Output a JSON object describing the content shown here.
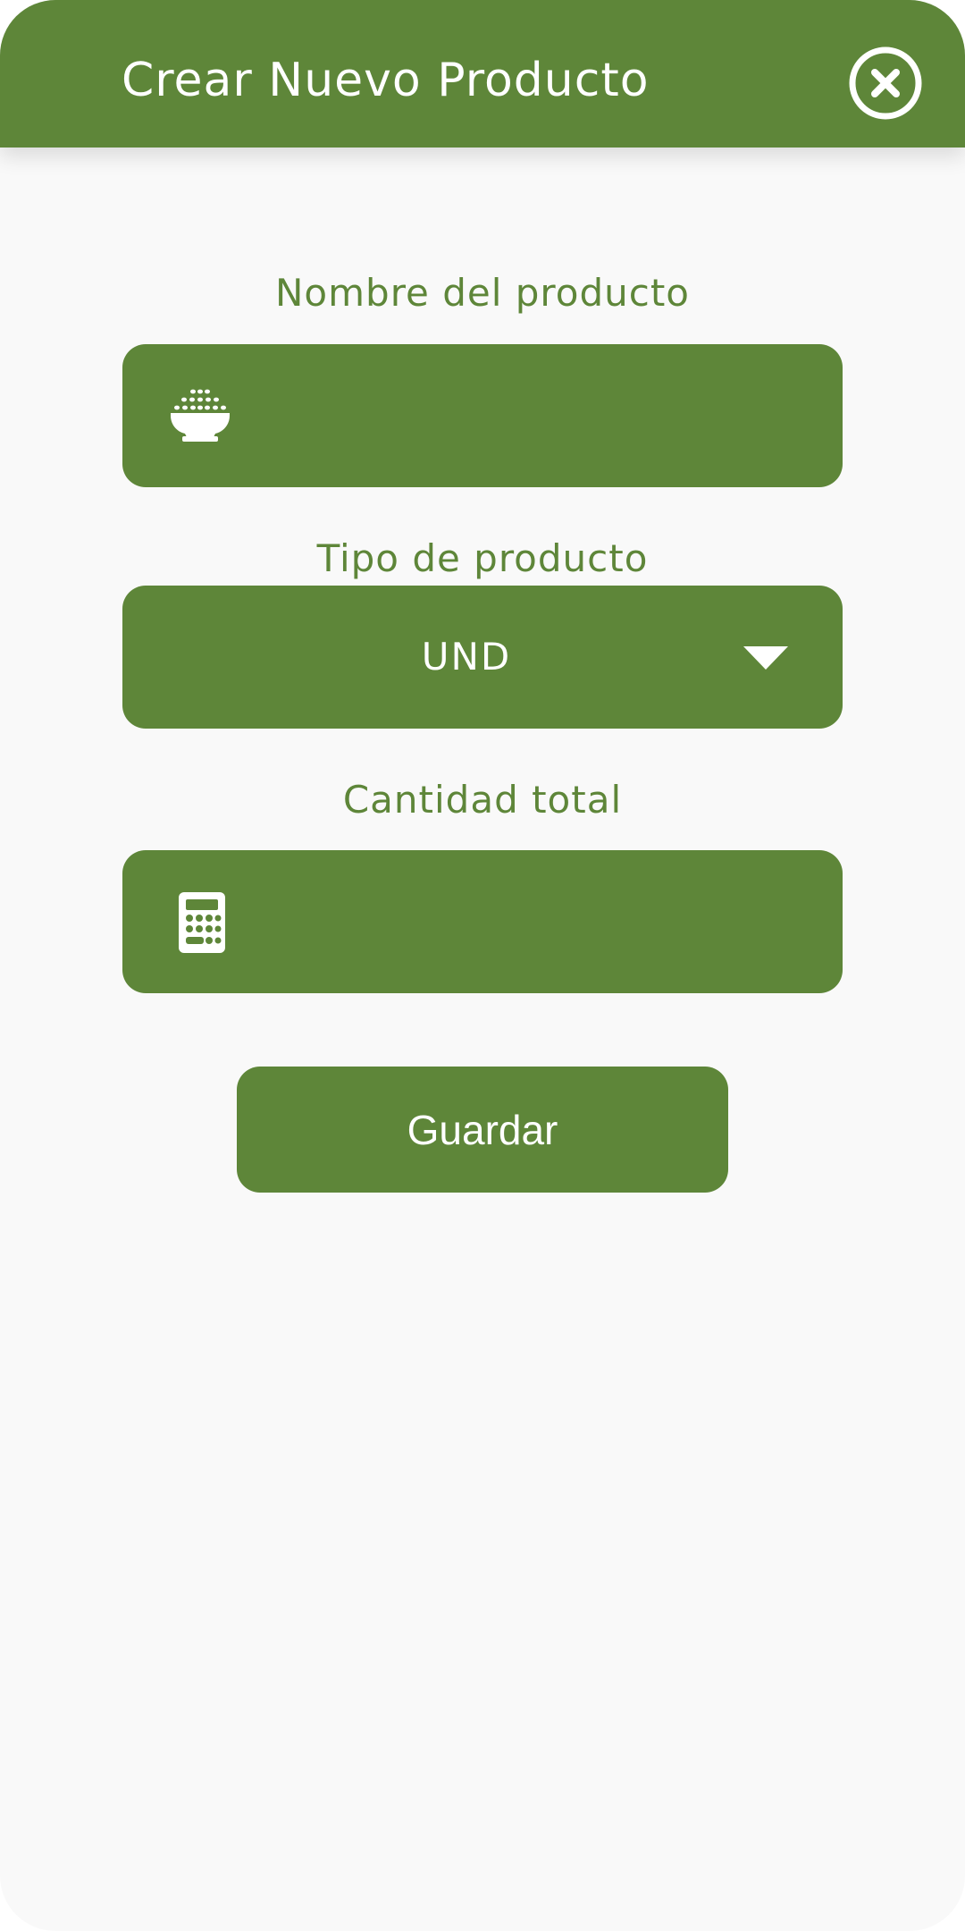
{
  "header": {
    "title": "Crear Nuevo Producto",
    "close_icon": "close-circle-icon"
  },
  "form": {
    "name_field": {
      "label": "Nombre del producto",
      "value": "",
      "placeholder": "",
      "icon": "rice-bowl-icon"
    },
    "type_field": {
      "label": "Tipo de producto",
      "selected": "UND",
      "icon": "dropdown-arrow-icon"
    },
    "quantity_field": {
      "label": "Cantidad total",
      "value": "",
      "placeholder": "",
      "icon": "calculator-icon"
    },
    "save_label": "Guardar"
  },
  "colors": {
    "primary": "#5e8639",
    "background": "#f9f9f9",
    "text_on_primary": "#ffffff"
  }
}
